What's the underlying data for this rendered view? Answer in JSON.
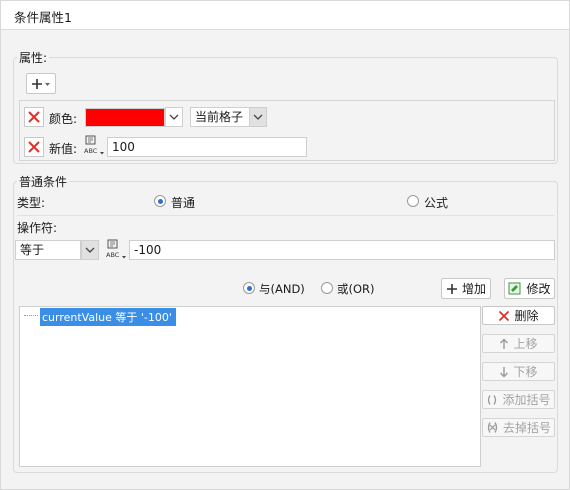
{
  "window": {
    "title": "条件属性1"
  },
  "properties": {
    "group_label": "属性:",
    "add_icon": "plus-icon",
    "color_row": {
      "label": "颜色:",
      "color": "#ff0000",
      "target_value": "当前格子"
    },
    "value_row": {
      "label": "新值:",
      "value": "100"
    }
  },
  "normal_condition": {
    "group_label": "普通条件",
    "type_label": "类型:",
    "type_options": [
      "普通",
      "公式"
    ],
    "type_selected": "普通",
    "operator_label": "操作符:",
    "operator_value": "等于",
    "operand_value": "-100"
  },
  "logic": {
    "and_label": "与(AND)",
    "or_label": "或(OR)",
    "selected": "与(AND)"
  },
  "actions": {
    "add": "增加",
    "modify": "修改",
    "delete": "删除",
    "move_up": "上移",
    "move_down": "下移",
    "add_bracket": "添加括号",
    "remove_bracket": "去掉括号"
  },
  "conditions": [
    "currentValue 等于 '-100'"
  ],
  "colors": {
    "accent": "#2d6fd1",
    "selection": "#3a8ee6",
    "delete_red": "#e0302c"
  }
}
